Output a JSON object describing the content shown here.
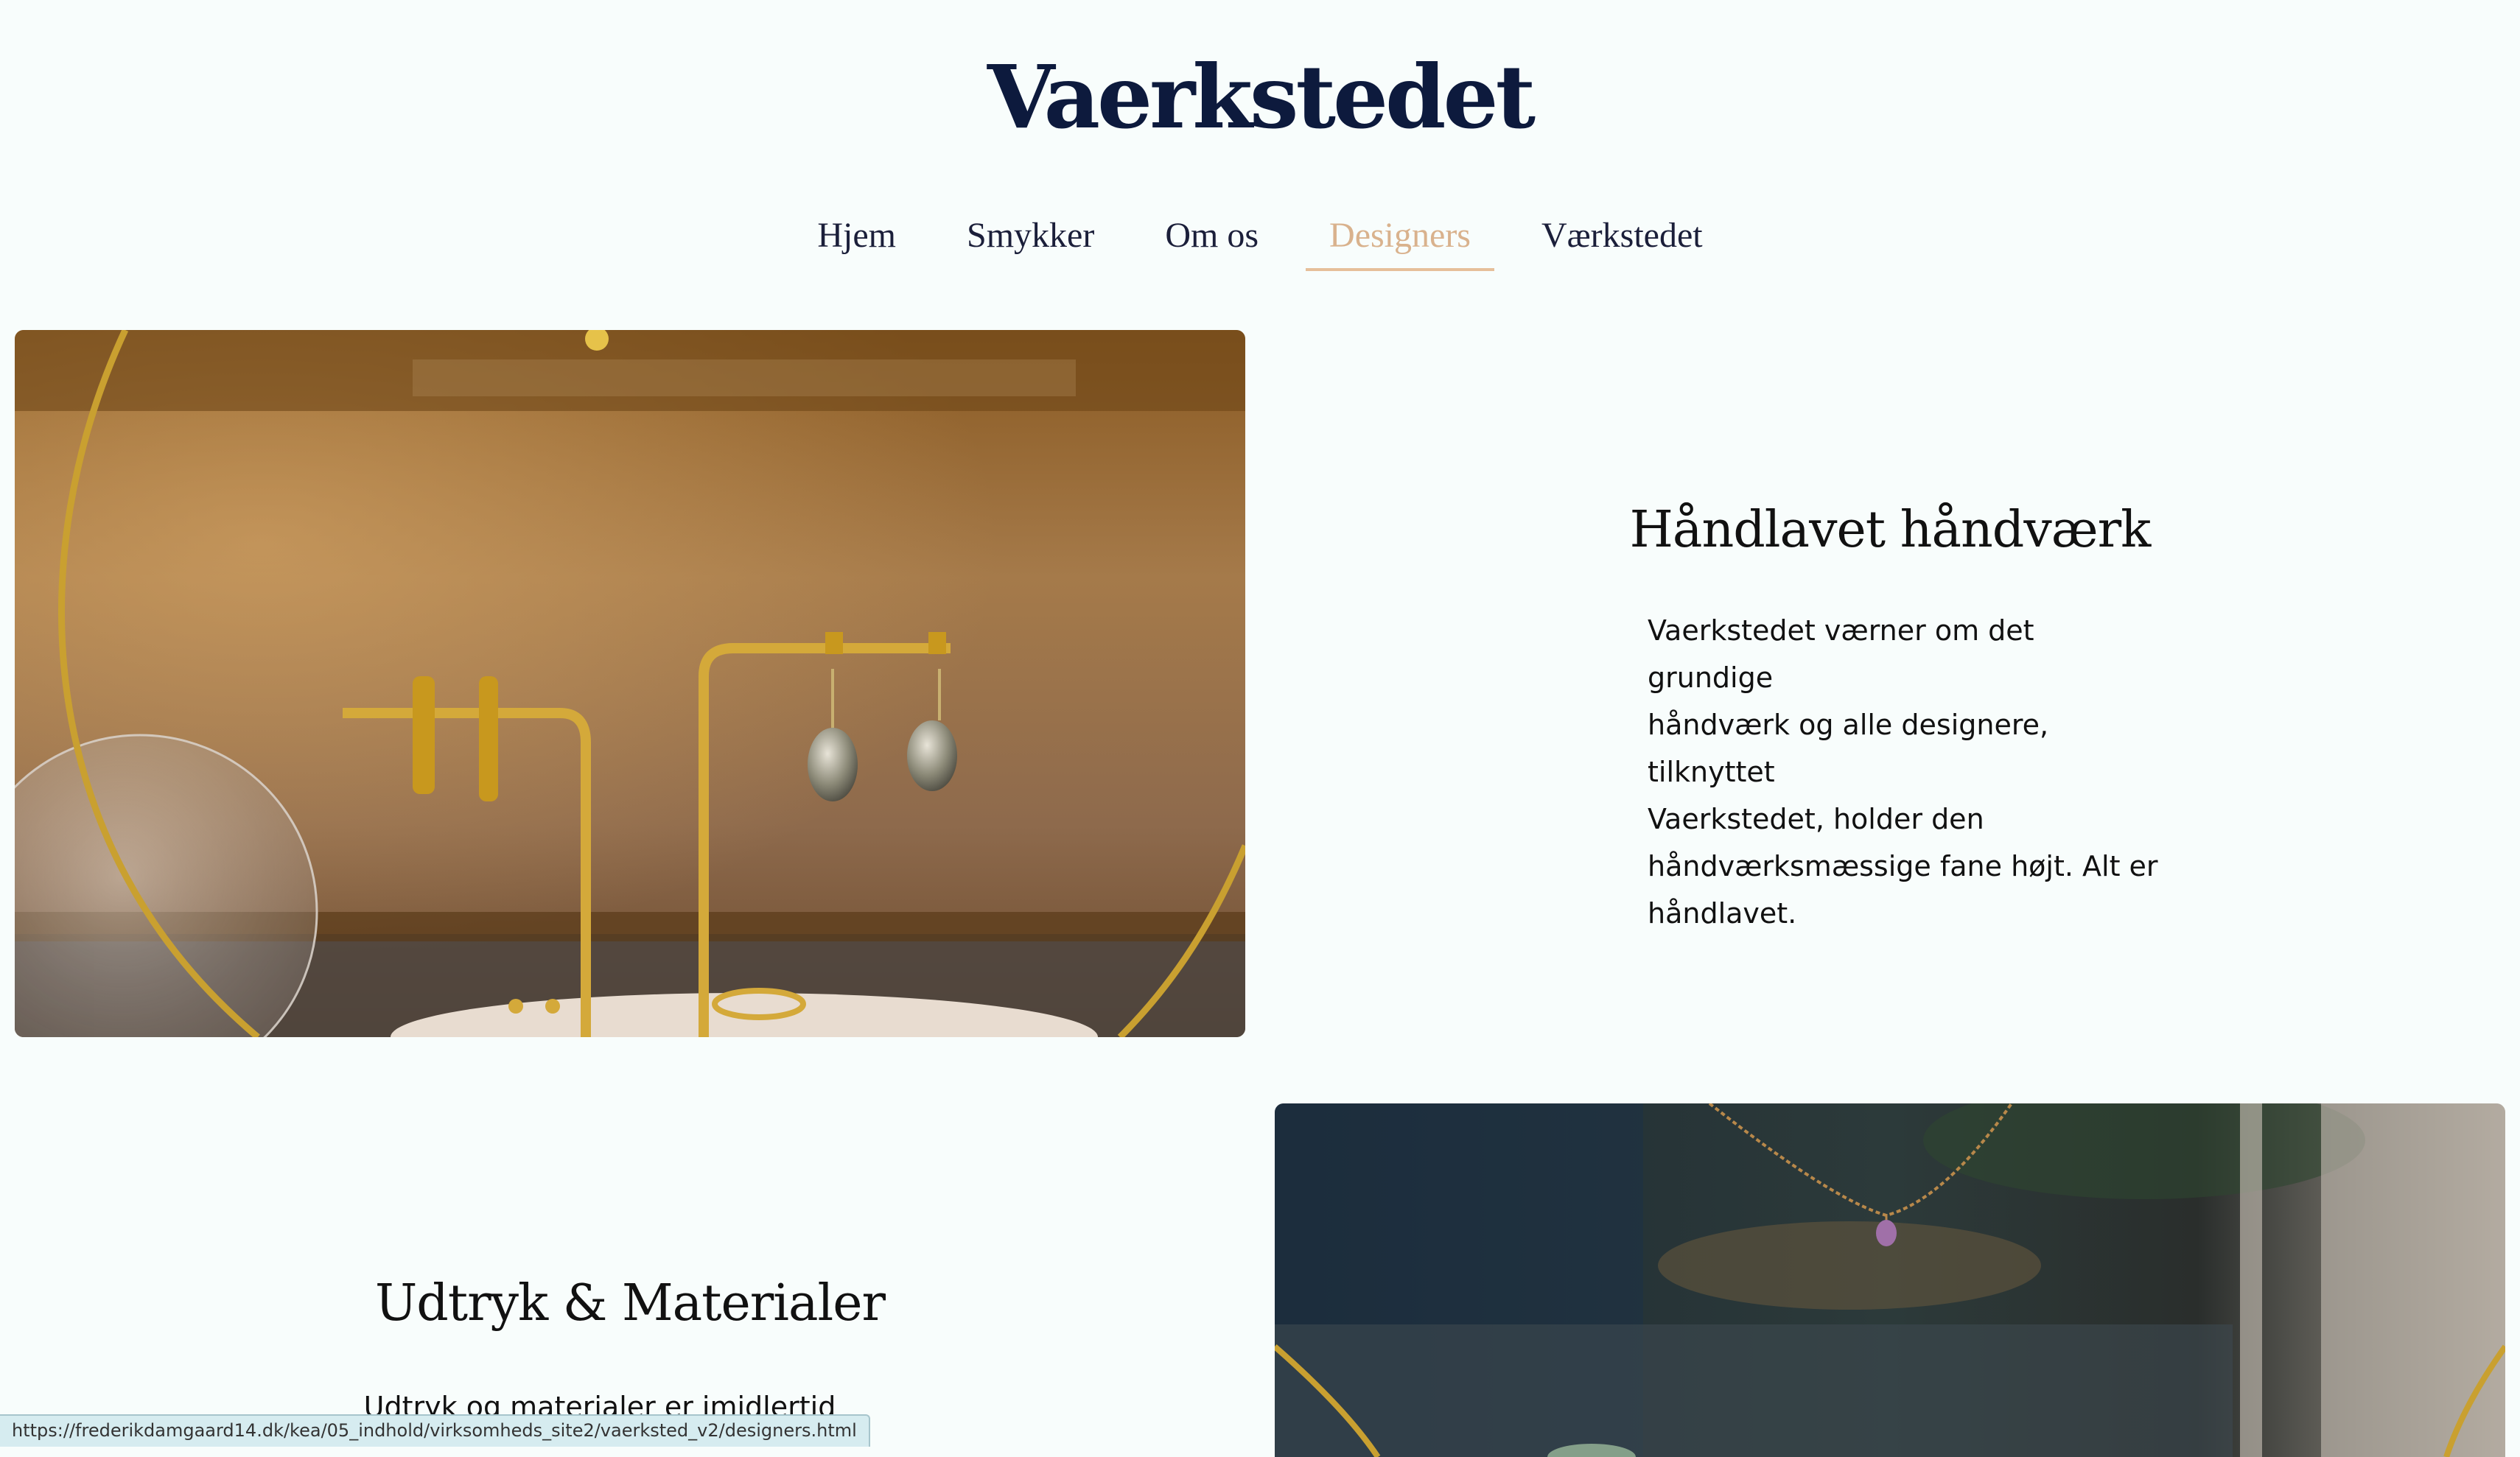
{
  "header": {
    "logo": "Vaerkstedet"
  },
  "nav": {
    "items": [
      {
        "label": "Hjem"
      },
      {
        "label": "Smykker"
      },
      {
        "label": "Om os"
      },
      {
        "label": "Designers"
      },
      {
        "label": "Værkstedet"
      }
    ],
    "active": "Designers"
  },
  "section1": {
    "heading": "Håndlavet håndværk",
    "lines": [
      "Vaerkstedet værner om det grundige",
      "håndværk og alle designere, tilknyttet",
      "Vaerkstedet, holder den",
      "håndværksmæssige fane højt. Alt er",
      "håndlavet."
    ]
  },
  "section2": {
    "heading": "Udtryk & Materialer",
    "first_line": "Udtryk og materialer er imidlertid"
  },
  "status_bar": {
    "url": "https://frederikdamgaard14.dk/kea/05_indhold/virksomheds_site2/vaerksted_v2/designers.html"
  },
  "colors": {
    "accent": "#d9b28d",
    "logo": "#0d1a3d",
    "background": "#f8fdfc"
  }
}
